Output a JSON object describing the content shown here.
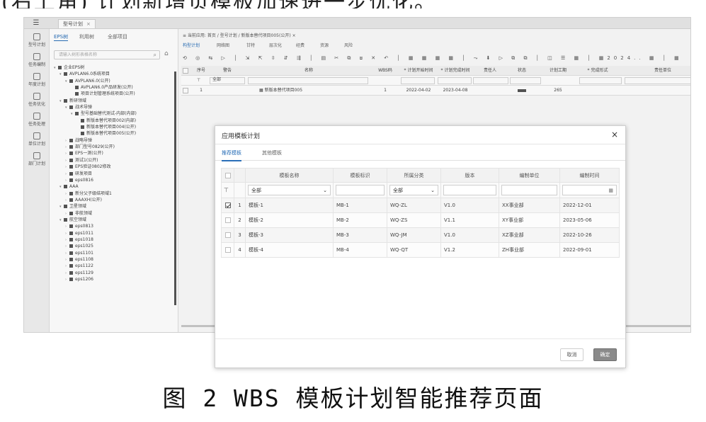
{
  "heading_text": "(右上角) 计划新增页模板加速进一步优化。",
  "window": {
    "menu_glyph": "☰",
    "tab_label": "型号计划",
    "tab_close": "×"
  },
  "rail": {
    "items": [
      {
        "label": "型号计划"
      },
      {
        "label": "任务编制"
      },
      {
        "label": "年度计划"
      },
      {
        "label": "任务优化"
      },
      {
        "label": "任务处理"
      },
      {
        "label": "单位计划"
      },
      {
        "label": "部门计划"
      }
    ]
  },
  "tree": {
    "tabs": [
      "EPS树",
      "利用树",
      "全部项目"
    ],
    "search_placeholder": "请输入树形表格名称",
    "search_glyph": "⌕",
    "home_glyph": "⌂",
    "nodes": [
      {
        "label": "企业EPS树",
        "level": 0,
        "toggle": "▾"
      },
      {
        "label": "AVPLAN6.0系统项目",
        "level": 1,
        "toggle": "▾"
      },
      {
        "label": "AVPLAN6.0(公开)",
        "level": 2,
        "toggle": "▾"
      },
      {
        "label": "AVPLAN6.0产品研发(公开)",
        "level": 3,
        "toggle": ""
      },
      {
        "label": "项目计划管理系统项目(公开)",
        "level": 3,
        "toggle": ""
      },
      {
        "label": "新研领域",
        "level": 1,
        "toggle": "▾"
      },
      {
        "label": "战术导弹",
        "level": 2,
        "toggle": "▾"
      },
      {
        "label": "型号基础替代测试-内部(内部)",
        "level": 3,
        "toggle": "▾"
      },
      {
        "label": "新版本替代项目002(内部)",
        "level": 4,
        "toggle": ""
      },
      {
        "label": "新版本替代项目004(公开)",
        "level": 4,
        "toggle": ""
      },
      {
        "label": "新版本替代项目005(公开)",
        "level": 4,
        "toggle": ""
      },
      {
        "label": "战略导弹",
        "level": 2,
        "toggle": "›"
      },
      {
        "label": "部门型号0829(公开)",
        "level": 2,
        "toggle": "›"
      },
      {
        "label": "EPS一测(公开)",
        "level": 2,
        "toggle": "›"
      },
      {
        "label": "测试1(公开)",
        "level": 2,
        "toggle": "›"
      },
      {
        "label": "EPS验证0802修改",
        "level": 2,
        "toggle": "›"
      },
      {
        "label": "研发项目",
        "level": 2,
        "toggle": "›"
      },
      {
        "label": "eps0816",
        "level": 2,
        "toggle": "›"
      },
      {
        "label": "AAA",
        "level": 1,
        "toggle": "▾"
      },
      {
        "label": "新分父子级结项域1",
        "level": 2,
        "toggle": "›"
      },
      {
        "label": "AAAXH(公开)",
        "level": 2,
        "toggle": "›"
      },
      {
        "label": "卫星领域",
        "level": 1,
        "toggle": "▾"
      },
      {
        "label": "非航领域",
        "level": 2,
        "toggle": "›"
      },
      {
        "label": "航空领域",
        "level": 1,
        "toggle": "▾"
      },
      {
        "label": "eps0813",
        "level": 2,
        "toggle": "›"
      },
      {
        "label": "eps1011",
        "level": 2,
        "toggle": "›"
      },
      {
        "label": "eps1018",
        "level": 2,
        "toggle": "›"
      },
      {
        "label": "eps1025",
        "level": 2,
        "toggle": "›"
      },
      {
        "label": "eps1101",
        "level": 2,
        "toggle": "›"
      },
      {
        "label": "eps1108",
        "level": 2,
        "toggle": "›"
      },
      {
        "label": "eps1122",
        "level": 2,
        "toggle": "›"
      },
      {
        "label": "eps1129",
        "level": 2,
        "toggle": "›"
      },
      {
        "label": "eps1206",
        "level": 2,
        "toggle": "›"
      }
    ]
  },
  "main": {
    "breadcrumb": "≡  当前应用: 首页  /  型号计划  /  新版本替代项目005(公开)  ×",
    "view_tabs": [
      "构型计划",
      "网络图",
      "甘特",
      "层次化",
      "经费",
      "资源",
      "风险"
    ],
    "toolbar_glyphs": "⟲ ◎ ⇆ ▷ │ ⇲ ⇱ ⇳ ⇵ ⇶ │ ▤ ✂ ⧉ ⧈ ✕ ↶ │ ▦ ▦ ▦ ▦ │ ⤳ ⬇ ▷ ⧉ ⧉ │ ◫ ☰ ▦ │ ▦2024.. ▦ │ ▦ ···  ▦ ▦全部",
    "columns": [
      "序号",
      "警告",
      "名称",
      "WBS码",
      "* 计划开始时间",
      "* 计划完成时间",
      "责任人",
      "状态",
      "计划工期",
      "* 完成形式",
      "责任单位"
    ],
    "filter_all": "全部",
    "filter_glyph": "⊤",
    "rows": [
      {
        "index": "1",
        "name": "新版本替代项目005",
        "wbs": "1",
        "start": "2022-04-02",
        "end": "2023-04-08",
        "duration": "265"
      }
    ]
  },
  "modal": {
    "title": "应用模板计划",
    "close": "×",
    "tabs": [
      "推荐模板",
      "其他模板"
    ],
    "columns": [
      "模板名称",
      "模板标识",
      "所属分类",
      "版本",
      "编制单位",
      "编制时间"
    ],
    "filter": {
      "name_value": "全部",
      "category_value": "全部",
      "dropdown_glyph": "⌄",
      "calendar_glyph": "▦",
      "filter_glyph": "⊤"
    },
    "rows": [
      {
        "checked": true,
        "index": "1",
        "name": "模板-1",
        "code": "MB-1",
        "category": "WQ-ZL",
        "version": "V1.0",
        "unit": "XX事业部",
        "date": "2022-12-01"
      },
      {
        "checked": false,
        "index": "2",
        "name": "模板-2",
        "code": "MB-2",
        "category": "WQ-ZS",
        "version": "V1.1",
        "unit": "XY事业部",
        "date": "2023-05-06"
      },
      {
        "checked": false,
        "index": "3",
        "name": "模板-3",
        "code": "MB-3",
        "category": "WQ-JM",
        "version": "V1.0",
        "unit": "XZ事业部",
        "date": "2022-10-26"
      },
      {
        "checked": false,
        "index": "4",
        "name": "模板-4",
        "code": "MB-4",
        "category": "WQ-QT",
        "version": "V1.2",
        "unit": "ZH事业部",
        "date": "2022-09-01"
      }
    ],
    "cancel_label": "取消",
    "ok_label": "确定"
  },
  "caption": "图 2  WBS 模板计划智能推荐页面",
  "colors": {
    "accent": "#2a6fb8",
    "ok_button": "#8a8a8a"
  }
}
